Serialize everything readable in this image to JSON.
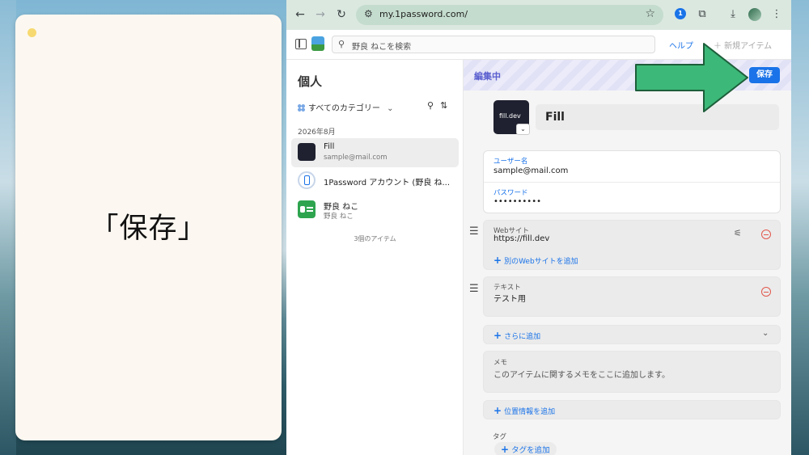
{
  "note": {
    "caption": "「保存」"
  },
  "browser": {
    "url": "my.1password.com/",
    "ext_1p_label": "1",
    "back_icon": "←",
    "forward_icon": "→",
    "reload_icon": "↻",
    "star_icon": "☆",
    "puzzle_icon": "⧉",
    "download_icon": "⤓",
    "menu_icon": "⋮"
  },
  "appbar": {
    "search_placeholder": "野良 ねこを検索",
    "help": "ヘルプ",
    "new_item": "＋ 新規アイテム"
  },
  "list": {
    "vault_title": "個人",
    "category": "すべてのカテゴリー",
    "month_header": "2026年8月",
    "items": [
      {
        "title": "Fill",
        "subtitle": "sample@mail.com"
      },
      {
        "title": "1Password アカウント (野良 ね...",
        "subtitle": ""
      },
      {
        "title": "野良 ねこ",
        "subtitle": "野良 ねこ"
      }
    ],
    "count_text": "3個のアイテム"
  },
  "editor": {
    "editing_label": "編集中",
    "save": "保存",
    "logo_text": "fill.dev",
    "title": "Fill",
    "username_label": "ユーザー名",
    "username_value": "sample@mail.com",
    "password_label": "パスワード",
    "password_value": "••••••••••",
    "website_label": "Webサイト",
    "website_value": "https://fill.dev",
    "add_website": "別のWebサイトを追加",
    "text_label": "テキスト",
    "text_value": "テスト用",
    "add_more": "さらに追加",
    "memo_label": "メモ",
    "memo_placeholder": "このアイテムに関するメモをここに追加します。",
    "add_location": "位置情報を追加",
    "tag_label": "タグ",
    "add_tag": "タグを追加"
  },
  "colors": {
    "accent": "#1a73e8",
    "editing_purple": "#5a5fcf",
    "remove_red": "#e2574c",
    "arrow_green": "#3cb878"
  }
}
